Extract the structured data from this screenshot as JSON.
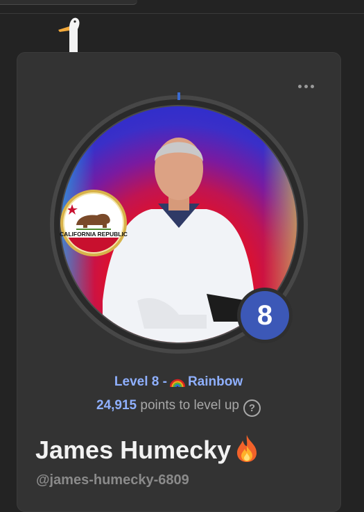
{
  "profile": {
    "level_text": "Level 8 -",
    "tier_name": "Rainbow",
    "tier_icon": "rainbow-icon",
    "points": "24,915",
    "points_suffix": "points to level up",
    "level_number": "8",
    "name": "James Humecky",
    "name_icon": "fire-icon",
    "handle": "@james-humecky-6809",
    "flag_text": "CALIFORNIA REPUBLIC"
  },
  "colors": {
    "accent_blue": "#8fb0ff",
    "badge_blue": "#3c58b7",
    "card_bg": "#333333",
    "page_bg": "#232323"
  }
}
